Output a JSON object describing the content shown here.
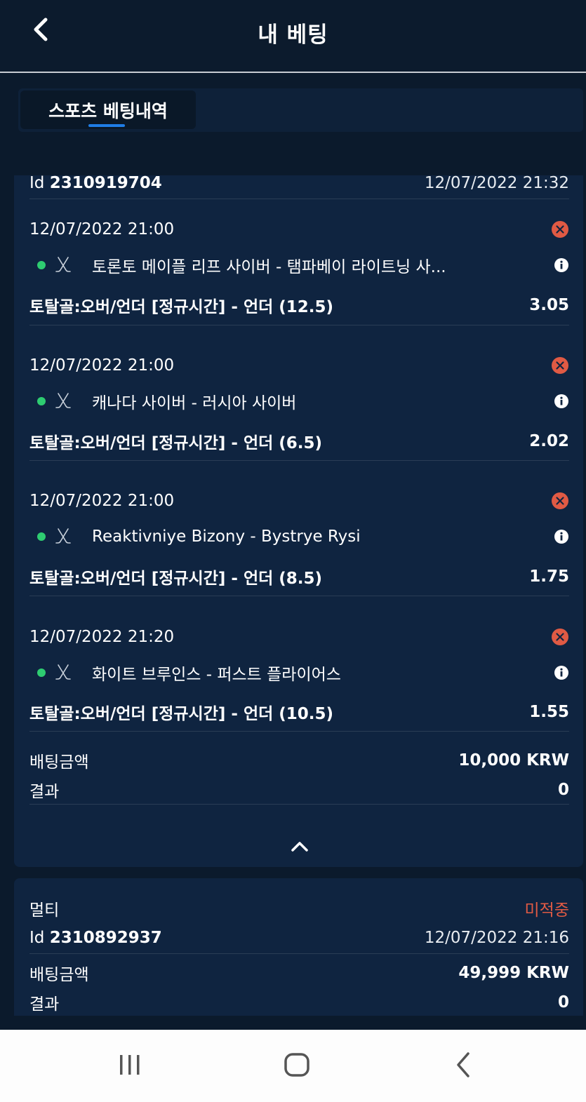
{
  "header": {
    "title": "내 베팅"
  },
  "tabs": [
    {
      "label": "스포츠 베팅내역"
    }
  ],
  "bet1": {
    "id_prefix": "Id",
    "id": "2310919704",
    "placed_at": "12/07/2022 21:32",
    "selections": [
      {
        "time": "12/07/2022 21:00",
        "match": "토론토 메이플 리프 사이버 - 탬파베이 라이트닝 사...",
        "market": "토탈골:오버/언더 [정규시간] - 언더 (12.5)",
        "odds": "3.05"
      },
      {
        "time": "12/07/2022 21:00",
        "match": "캐나다 사이버 - 러시아 사이버",
        "market": "토탈골:오버/언더 [정규시간] - 언더 (6.5)",
        "odds": "2.02"
      },
      {
        "time": "12/07/2022 21:00",
        "match": "Reaktivniye Bizony - Bystrye Rysi",
        "market": "토탈골:오버/언더 [정규시간] - 언더 (8.5)",
        "odds": "1.75"
      },
      {
        "time": "12/07/2022 21:20",
        "match": "화이트 브루인스 - 퍼스트 플라이어스",
        "market": "토탈골:오버/언더 [정규시간] - 언더 (10.5)",
        "odds": "1.55"
      }
    ],
    "stake_label": "배팅금액",
    "stake": "10,000 KRW",
    "result_label": "결과",
    "result": "0"
  },
  "bet2": {
    "type": "멀티",
    "status": "미적중",
    "id_prefix": "Id",
    "id": "2310892937",
    "placed_at": "12/07/2022 21:16",
    "stake_label": "배팅금액",
    "stake": "49,999 KRW",
    "result_label": "결과",
    "result": "0"
  },
  "colors": {
    "background": "#0b1a2c",
    "card": "#0f2440",
    "accent": "#1f7de6",
    "lost": "#e05a44",
    "live_dot": "#2ecc71"
  },
  "icons": {
    "back": "chevron-left-icon",
    "sport": "hockey-sticks-icon",
    "info": "info-icon",
    "lost": "x-circle-icon",
    "collapse": "chevron-up-icon"
  }
}
